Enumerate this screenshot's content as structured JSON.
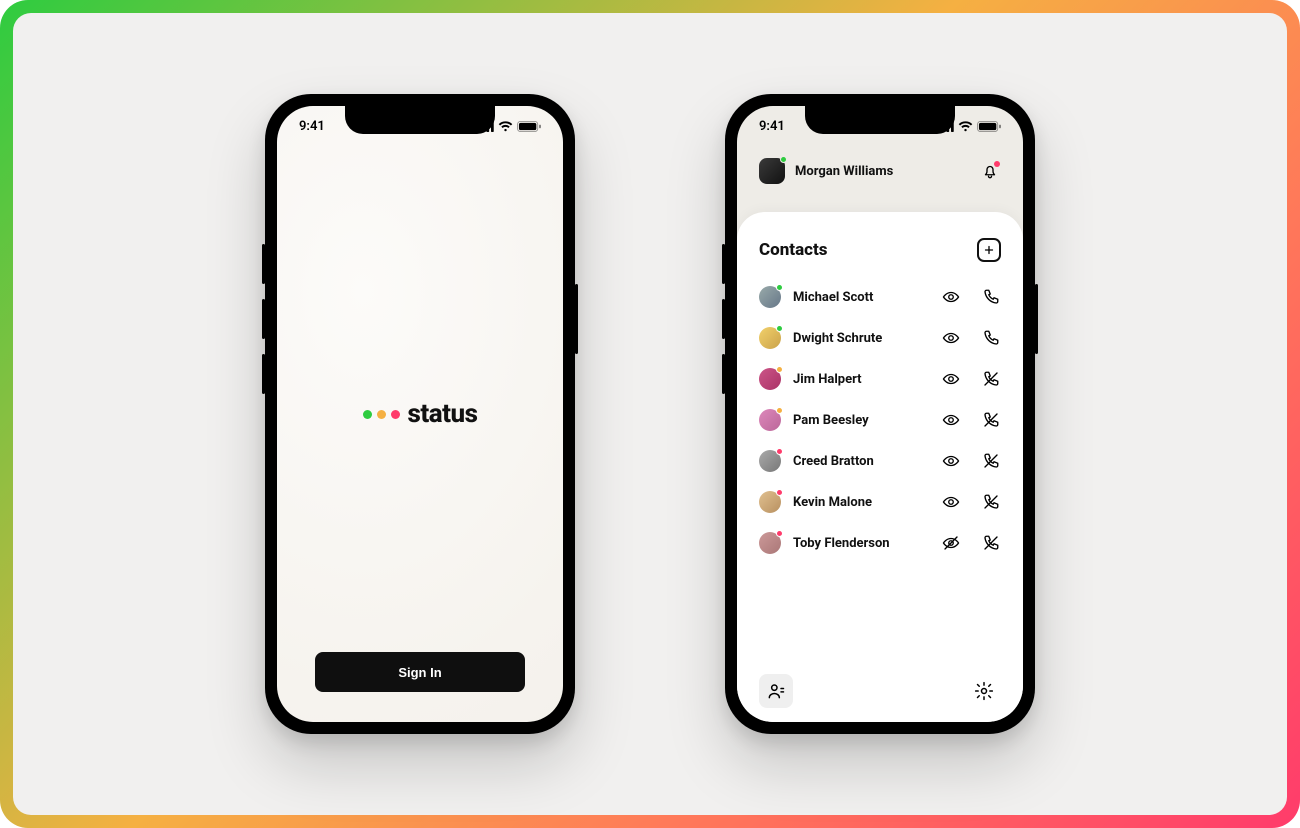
{
  "statusbar": {
    "time": "9:41"
  },
  "logo": {
    "text": "status",
    "dot_colors": [
      "#2ecc40",
      "#f5b042",
      "#ff3b6b"
    ]
  },
  "splash": {
    "sign_in_label": "Sign In"
  },
  "app": {
    "me": {
      "name": "Morgan Williams",
      "status": "green"
    },
    "contacts_title": "Contacts",
    "contacts": [
      {
        "name": "Michael Scott",
        "status": "green",
        "visible": true,
        "callable": true
      },
      {
        "name": "Dwight Schrute",
        "status": "green",
        "visible": true,
        "callable": true
      },
      {
        "name": "Jim Halpert",
        "status": "yellow",
        "visible": true,
        "callable": false
      },
      {
        "name": "Pam Beesley",
        "status": "yellow",
        "visible": true,
        "callable": false
      },
      {
        "name": "Creed Bratton",
        "status": "red",
        "visible": true,
        "callable": false
      },
      {
        "name": "Kevin Malone",
        "status": "red",
        "visible": true,
        "callable": false
      },
      {
        "name": "Toby Flenderson",
        "status": "red",
        "visible": false,
        "callable": false
      }
    ]
  }
}
